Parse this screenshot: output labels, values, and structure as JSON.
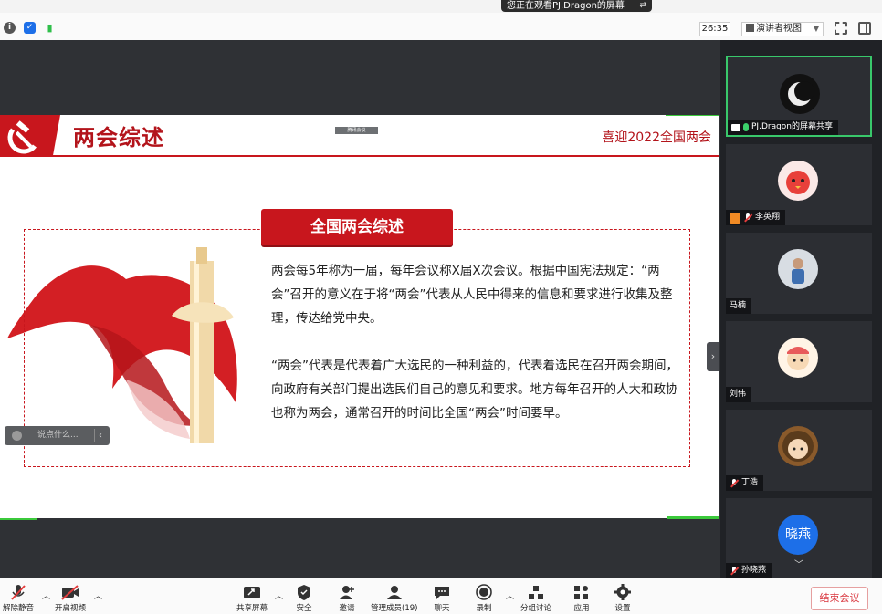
{
  "share_banner": {
    "text": "您正在观看PJ.Dragon的屏幕"
  },
  "topbar": {
    "timer": "26:35",
    "view_mode": "演讲者视图"
  },
  "slide": {
    "title": "两会综述",
    "subtitle": "喜迎2022全国两会",
    "watermark": "腾讯会议",
    "section_title": "全国两会综述",
    "paragraph1": "两会每5年称为一届，每年会议称X届X次会议。根据中国宪法规定：“两会”召开的意义在于将“两会”代表从人民中得来的信息和要求进行收集及整理，传达给党中央。",
    "paragraph2": "“两会”代表是代表着广大选民的一种利益的，代表着选民在召开两会期间，向政府有关部门提出选民们自己的意见和要求。地方每年召开的人大和政协也称为两会，通常召开的时间比全国“两会”时间要早。"
  },
  "chat": {
    "placeholder": "说点什么..."
  },
  "participants": [
    {
      "name": "PJ.Dragon的屏幕共享",
      "avatar": "crescent-moon-avatar",
      "active": true
    },
    {
      "name": "李英翔",
      "avatar": "red-bird-avatar"
    },
    {
      "name": "马楠",
      "avatar": "child-photo-avatar"
    },
    {
      "name": "刘伟",
      "avatar": "cartoon-avatar"
    },
    {
      "name": "丁浩",
      "avatar": "girl-cartoon-avatar"
    },
    {
      "name": "孙晓燕",
      "avatar_text": "晓燕"
    }
  ],
  "bottombar": {
    "unmute": "解除静音",
    "start_video": "开启视频",
    "share_screen": "共享屏幕",
    "security": "安全",
    "invite": "邀请",
    "manage_members": "管理成员(19)",
    "chat": "聊天",
    "record": "录制",
    "breakout": "分组讨论",
    "apps": "应用",
    "settings": "设置",
    "end_meeting": "结束会议"
  },
  "colors": {
    "brand_red": "#c8161d",
    "active_green": "#39c86b",
    "end_red": "#d9363e"
  }
}
